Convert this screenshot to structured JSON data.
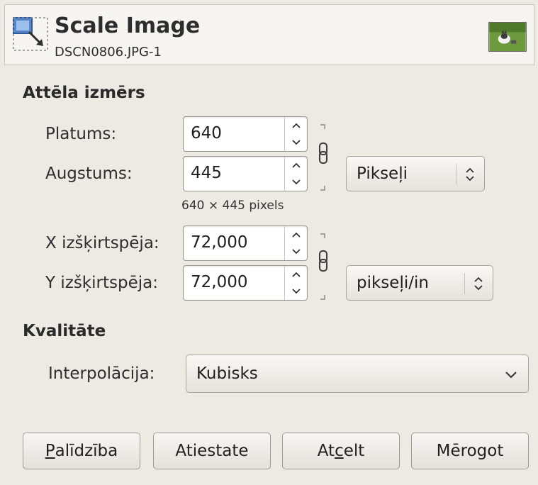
{
  "header": {
    "title": "Scale Image",
    "subtitle": "DSCN0806.JPG-1",
    "icon": "scale-image-icon",
    "thumbnail": "image-thumbnail"
  },
  "image_size": {
    "section_title": "Attēla izmērs",
    "width_label": "Platums:",
    "width_value": "640",
    "height_label": "Augstums:",
    "height_value": "445",
    "dimensions_text": "640 × 445 pixels",
    "unit": "Pikseļi",
    "xres_label": "X izšķirtspēja:",
    "xres_value": "72,000",
    "yres_label": "Y izšķirtspēja:",
    "yres_value": "72,000",
    "res_unit": "pikseļi/in"
  },
  "quality": {
    "section_title": "Kvalitāte",
    "interpolation_label": "Interpolācija:",
    "interpolation_value": "Kubisks"
  },
  "buttons": {
    "help": {
      "mnemonic": "P",
      "rest": "alīdzība"
    },
    "reset": "Atiestate",
    "cancel": {
      "before": "At",
      "mnemonic": "c",
      "after": "elt"
    },
    "scale": "Mērogot"
  },
  "colors": {
    "background": "#ede9e3",
    "header_bg": "#f7f5f2",
    "input_bg": "#ffffff"
  }
}
